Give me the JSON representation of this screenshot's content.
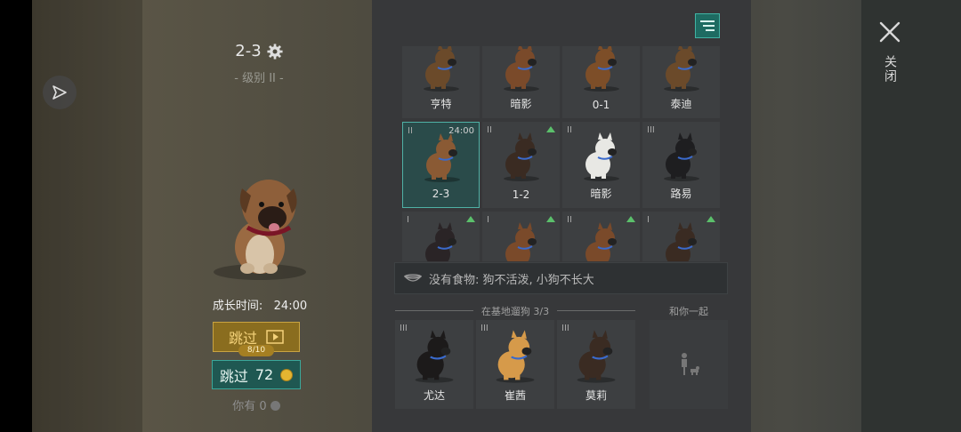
{
  "header": {
    "level_title": "2-3",
    "level_sub": "- 级别 II -"
  },
  "left_panel": {
    "grow_time_label": "成长时间:",
    "grow_time_value": "24:00",
    "skip_ad_label": "跳过",
    "skip_ad_count": "8/10",
    "skip_coin_label": "跳过",
    "skip_coin_cost": "72",
    "you_have_label": "你有",
    "you_have_value": "0"
  },
  "grid": {
    "cells": [
      {
        "tier": "",
        "time": "",
        "up": false,
        "name": "亨特",
        "color": "#6b4a2a"
      },
      {
        "tier": "",
        "time": "",
        "up": false,
        "name": "暗影",
        "color": "#7a4a2a"
      },
      {
        "tier": "",
        "time": "",
        "up": false,
        "name": "0-1",
        "color": "#7d4e28"
      },
      {
        "tier": "",
        "time": "",
        "up": false,
        "name": "泰迪",
        "color": "#6b4a2a"
      },
      {
        "tier": "II",
        "time": "24:00",
        "up": false,
        "name": "2-3",
        "color": "#8a5a34",
        "selected": true
      },
      {
        "tier": "II",
        "time": "",
        "up": true,
        "name": "1-2",
        "color": "#3a2b22"
      },
      {
        "tier": "II",
        "time": "",
        "up": false,
        "name": "暗影",
        "color": "#e8e8e4"
      },
      {
        "tier": "III",
        "time": "",
        "up": false,
        "name": "路易",
        "color": "#1e1e20"
      },
      {
        "tier": "I",
        "time": "",
        "up": true,
        "name": "",
        "color": "#2a2426"
      },
      {
        "tier": "I",
        "time": "",
        "up": true,
        "name": "",
        "color": "#7a4a2a"
      },
      {
        "tier": "II",
        "time": "",
        "up": true,
        "name": "",
        "color": "#7a4a2a"
      },
      {
        "tier": "I",
        "time": "",
        "up": true,
        "name": "",
        "color": "#3a2b22"
      }
    ]
  },
  "food_notice": "没有食物: 狗不活泼, 小狗不长大",
  "walk": {
    "section_label": "在基地遛狗",
    "section_count": "3/3",
    "dogs": [
      {
        "tier": "III",
        "name": "尤达",
        "color": "#1c1a1a"
      },
      {
        "tier": "III",
        "name": "崔茜",
        "color": "#d69a4a"
      },
      {
        "tier": "III",
        "name": "莫莉",
        "color": "#3a2b22"
      }
    ]
  },
  "with_you_label": "和你一起",
  "close_label": "关闭",
  "colors": {
    "accent_teal": "#41b3a4",
    "accent_gold": "#c9a441",
    "up_arrow": "#5bc06b"
  }
}
